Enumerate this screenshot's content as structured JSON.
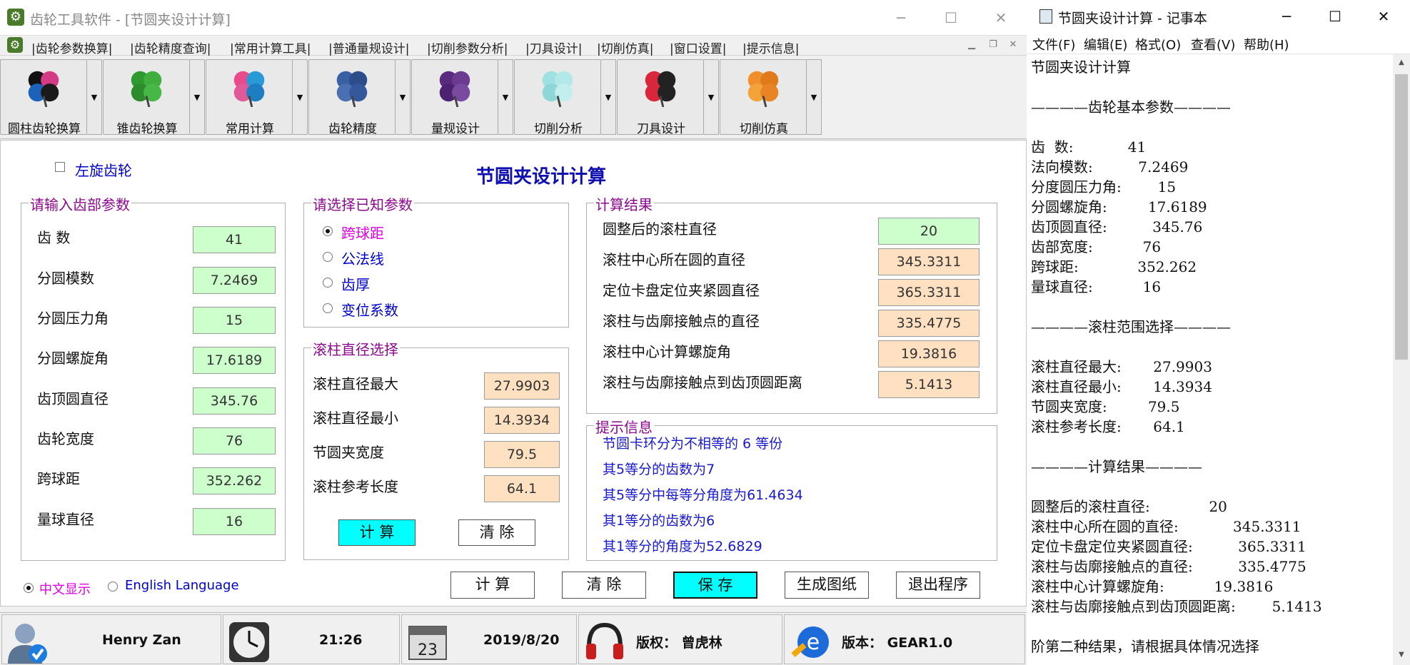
{
  "app": {
    "title": "齿轮工具软件 - [节圆夹设计计算]",
    "icon": "gear-settings-icon"
  },
  "menu": [
    {
      "label": "|齿轮参数换算|"
    },
    {
      "label": "|齿轮精度查询|"
    },
    {
      "label": "|常用计算工具|"
    },
    {
      "label": "|普通量规设计|"
    },
    {
      "label": "|切削参数分析|"
    },
    {
      "label": "|刀具设计|"
    },
    {
      "label": "|切削仿真|"
    },
    {
      "label": "|窗口设置|"
    },
    {
      "label": "|提示信息|"
    }
  ],
  "toolbar": [
    {
      "label": "圆柱齿轮换算",
      "colors": [
        "#111111",
        "#d43a86",
        "#1d62b9",
        "#1a1a1a"
      ]
    },
    {
      "label": "锥齿轮换算",
      "colors": [
        "#2f9a2f",
        "#3fae3f",
        "#2c8c2c",
        "#46b846"
      ]
    },
    {
      "label": "常用计算",
      "colors": [
        "#e94b8a",
        "#2a9ad6",
        "#e05a9a",
        "#1d7ec2"
      ]
    },
    {
      "label": "齿轮精度",
      "colors": [
        "#3a5fa3",
        "#2c4d8a",
        "#4a6fb3",
        "#33589c"
      ]
    },
    {
      "label": "量规设计",
      "colors": [
        "#5a2a7e",
        "#6d3a92",
        "#4d2270",
        "#7a4aa0"
      ]
    },
    {
      "label": "切削分析",
      "colors": [
        "#9fe0e0",
        "#b3e8e8",
        "#8fd6d6",
        "#c2eeee"
      ]
    },
    {
      "label": "刀具设计",
      "colors": [
        "#d8263d",
        "#222222",
        "#d8263d",
        "#222222"
      ]
    },
    {
      "label": "切削仿真",
      "colors": [
        "#f0902c",
        "#e07a1a",
        "#f4a23a",
        "#e88424"
      ]
    }
  ],
  "form": {
    "left_hand_label": "左旋齿轮",
    "title": "节圆夹设计计算",
    "input_group": {
      "title": "请输入齿部参数",
      "rows": [
        {
          "label": "齿 数",
          "value": "41"
        },
        {
          "label": "分圆模数",
          "value": "7.2469"
        },
        {
          "label": "分圆压力角",
          "value": "15"
        },
        {
          "label": "分圆螺旋角",
          "value": "17.6189"
        },
        {
          "label": "齿顶圆直径",
          "value": "345.76"
        },
        {
          "label": "齿轮宽度",
          "value": "76"
        },
        {
          "label": "跨球距",
          "value": "352.262"
        },
        {
          "label": "量球直径",
          "value": "16"
        }
      ]
    },
    "known_group": {
      "title": "请选择已知参数",
      "options": [
        {
          "label": "跨球距",
          "selected": true
        },
        {
          "label": "公法线",
          "selected": false
        },
        {
          "label": "齿厚",
          "selected": false
        },
        {
          "label": "变位系数",
          "selected": false
        }
      ]
    },
    "roller_group": {
      "title": "滚柱直径选择",
      "rows": [
        {
          "label": "滚柱直径最大",
          "value": "27.9903"
        },
        {
          "label": "滚柱直径最小",
          "value": "14.3934"
        },
        {
          "label": "节圆夹宽度",
          "value": "79.5"
        },
        {
          "label": "滚柱参考长度",
          "value": "64.1"
        }
      ],
      "calc_label": "计  算",
      "clear_label": "清  除"
    },
    "result_group": {
      "title": "计算结果",
      "rows": [
        {
          "label": "圆整后的滚柱直径",
          "value": "20"
        },
        {
          "label": "滚柱中心所在圆的直径",
          "value": "345.3311"
        },
        {
          "label": "定位卡盘定位夹紧圆直径",
          "value": "365.3311"
        },
        {
          "label": "滚柱与齿廓接触点的直径",
          "value": "335.4775"
        },
        {
          "label": "滚柱中心计算螺旋角",
          "value": "19.3816"
        },
        {
          "label": "滚柱与齿廓接触点到齿顶圆距离",
          "value": "5.1413"
        }
      ]
    },
    "hint_group": {
      "title": "提示信息",
      "lines": [
        "节圆卡环分为不相等的 6 等份",
        "其5等分的齿数为7",
        "其5等分中每等分角度为61.4634",
        "其1等分的齿数为6",
        "其1等分的角度为52.6829"
      ]
    },
    "lang": {
      "zh": "中文显示",
      "en": "English Language"
    },
    "buttons": {
      "calc": "计  算",
      "clear": "清  除",
      "save": "保  存",
      "drawing": "生成图纸",
      "exit": "退出程序"
    }
  },
  "status": {
    "user": "Henry Zan",
    "time": "21:26",
    "date": "2019/8/20",
    "calendar_day": "23",
    "copyright": "版权： 曾虎林",
    "version": "版本： GEAR1.0"
  },
  "notepad": {
    "title": "节圆夹设计计算 - 记事本",
    "menu": [
      "文件(F)",
      "编辑(E)",
      "格式(O)",
      "查看(V)",
      "帮助(H)"
    ],
    "lines": [
      "节圆夹设计计算",
      "",
      "————齿轮基本参数————",
      "",
      "齿  数:            41",
      "法向模数:          7.2469",
      "分度圆压力角:        15",
      "分圆螺旋角:         17.6189",
      "齿顶圆直径:          345.76",
      "齿部宽度:           76",
      "跨球距:             352.262",
      "量球直径:           16",
      "",
      "————滚柱范围选择————",
      "",
      "滚柱直径最大:       27.9903",
      "滚柱直径最小:       14.3934",
      "节圆夹宽度:         79.5",
      "滚柱参考长度:       64.1",
      "",
      "————计算结果————",
      "",
      "圆整后的滚柱直径:             20",
      "滚柱中心所在圆的直径:            345.3311",
      "定位卡盘定位夹紧圆直径:          365.3311",
      "滚柱与齿廓接触点的直径:          335.4775",
      "滚柱中心计算螺旋角:           19.3816",
      "滚柱与齿廓接触点到齿顶圆距离:        5.1413",
      "",
      "阶第二种结果，请根据具体情况选择"
    ]
  }
}
